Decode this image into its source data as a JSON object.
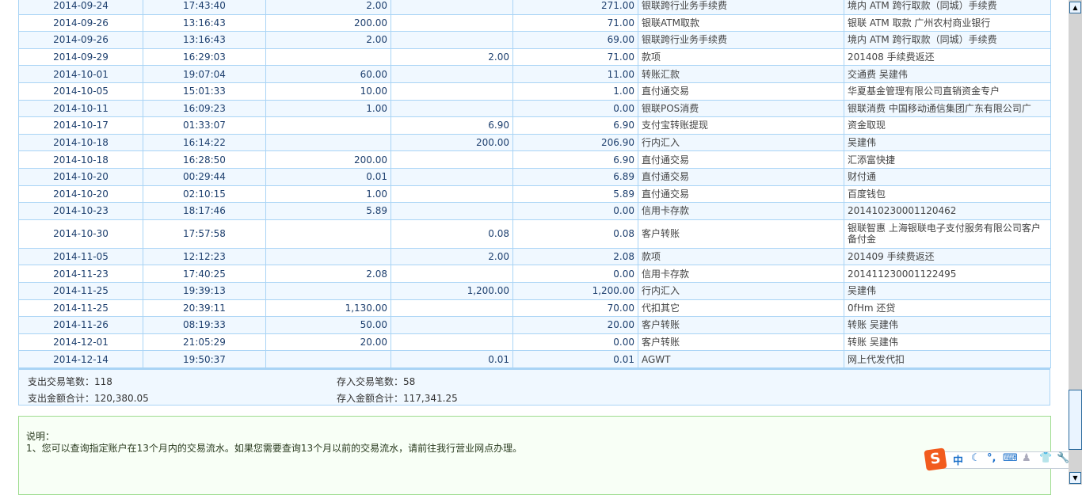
{
  "rows": [
    [
      "2014-09-24",
      "17:43:40",
      "2.00",
      "",
      "271.00",
      "银联跨行业务手续费",
      "境内 ATM 跨行取款（同城）手续费"
    ],
    [
      "2014-09-26",
      "13:16:43",
      "200.00",
      "",
      "71.00",
      "银联ATM取款",
      "银联 ATM 取款 广州农村商业银行"
    ],
    [
      "2014-09-26",
      "13:16:43",
      "2.00",
      "",
      "69.00",
      "银联跨行业务手续费",
      "境内 ATM 跨行取款（同城）手续费"
    ],
    [
      "2014-09-29",
      "16:29:03",
      "",
      "2.00",
      "71.00",
      "款项",
      "201408 手续费返还"
    ],
    [
      "2014-10-01",
      "19:07:04",
      "60.00",
      "",
      "11.00",
      "转账汇款",
      "交通费 吴建伟"
    ],
    [
      "2014-10-05",
      "15:01:33",
      "10.00",
      "",
      "1.00",
      "直付通交易",
      "华夏基金管理有限公司直销资金专户"
    ],
    [
      "2014-10-11",
      "16:09:23",
      "1.00",
      "",
      "0.00",
      "银联POS消费",
      "银联消费 中国移动通信集团广东有限公司广"
    ],
    [
      "2014-10-17",
      "01:33:07",
      "",
      "6.90",
      "6.90",
      "支付宝转账提现",
      "资金取现"
    ],
    [
      "2014-10-18",
      "16:14:22",
      "",
      "200.00",
      "206.90",
      "行内汇入",
      "吴建伟"
    ],
    [
      "2014-10-18",
      "16:28:50",
      "200.00",
      "",
      "6.90",
      "直付通交易",
      "汇添富快捷"
    ],
    [
      "2014-10-20",
      "00:29:44",
      "0.01",
      "",
      "6.89",
      "直付通交易",
      "财付通"
    ],
    [
      "2014-10-20",
      "02:10:15",
      "1.00",
      "",
      "5.89",
      "直付通交易",
      "百度钱包"
    ],
    [
      "2014-10-23",
      "18:17:46",
      "5.89",
      "",
      "0.00",
      "信用卡存款",
      "201410230001120462"
    ],
    [
      "2014-10-30",
      "17:57:58",
      "",
      "0.08",
      "0.08",
      "客户转账",
      "银联智惠 上海银联电子支付服务有限公司客户备付金"
    ],
    [
      "2014-11-05",
      "12:12:23",
      "",
      "2.00",
      "2.08",
      "款项",
      "201409 手续费返还"
    ],
    [
      "2014-11-23",
      "17:40:25",
      "2.08",
      "",
      "0.00",
      "信用卡存款",
      "201411230001122495"
    ],
    [
      "2014-11-25",
      "19:39:13",
      "",
      "1,200.00",
      "1,200.00",
      "行内汇入",
      "吴建伟"
    ],
    [
      "2014-11-25",
      "20:39:11",
      "1,130.00",
      "",
      "70.00",
      "代扣其它",
      "0fHm 还贷"
    ],
    [
      "2014-11-26",
      "08:19:33",
      "50.00",
      "",
      "20.00",
      "客户转账",
      "转账 吴建伟"
    ],
    [
      "2014-12-01",
      "21:05:29",
      "20.00",
      "",
      "0.00",
      "客户转账",
      "转账 吴建伟"
    ],
    [
      "2014-12-14",
      "19:50:37",
      "",
      "0.01",
      "0.01",
      "AGWT",
      "网上代发代扣"
    ]
  ],
  "summary": {
    "out_count_label": "支出交易笔数：",
    "out_count": "118",
    "in_count_label": "存入交易笔数：",
    "in_count": "58",
    "out_total_label": "支出金额合计：",
    "out_total": "120,380.05",
    "in_total_label": "存入金额合计：",
    "in_total": "117,341.25"
  },
  "note": {
    "title": "说明：",
    "line1": "1、您可以查询指定账户在13个月内的交易流水。如果您需要查询13个月以前的交易流水，请前往我行营业网点办理。"
  },
  "ime": {
    "logo": "S",
    "mode": "中",
    "icons": [
      "moon-icon",
      "punctuation-icon",
      "keyboard-icon",
      "user-icon",
      "skin-icon",
      "settings-wrench-icon"
    ]
  },
  "colors": {
    "border": "#a9d4f5",
    "row_alt": "#f0f8ff",
    "note_border": "#9edc8f"
  }
}
